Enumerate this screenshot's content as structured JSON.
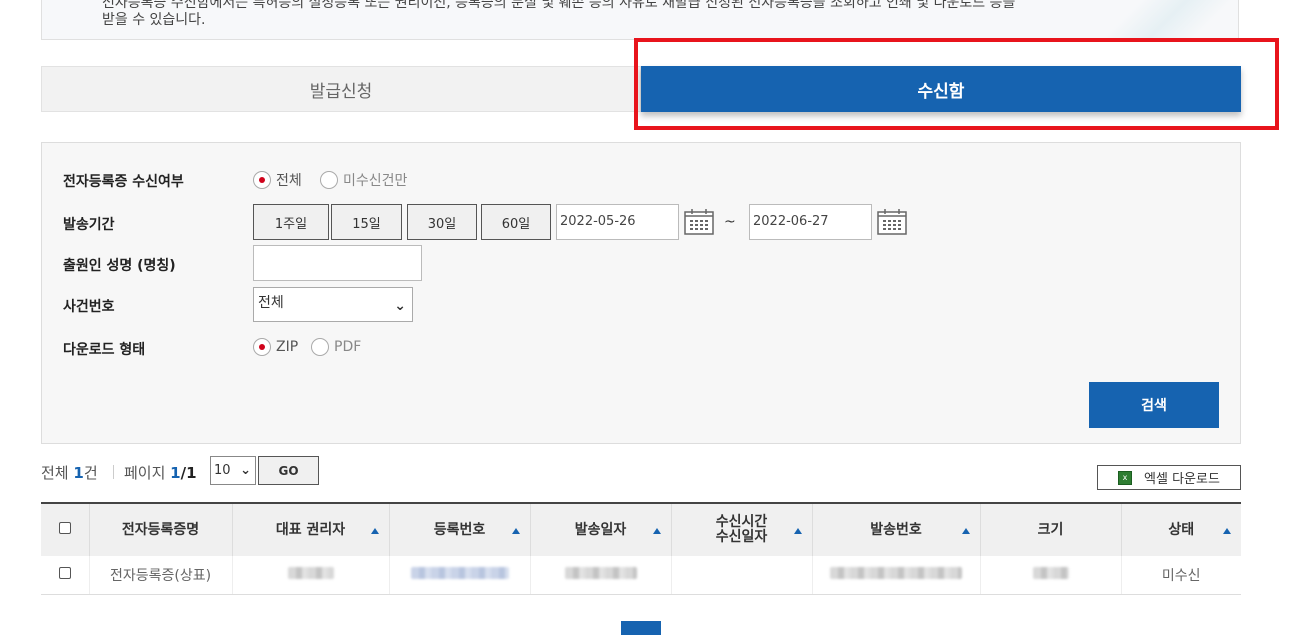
{
  "notice": {
    "line1": "전자등록증 수신함에서는 특허등의 설정등록 또는 권리이전, 등록증의 분실 및 훼손 등의 사유로 재발급 신청된 전자등록증을 조회하고 인쇄 및 다운로드 등을",
    "line2": "받을 수 있습니다."
  },
  "tabs": {
    "apply": "발급신청",
    "inbox": "수신함"
  },
  "filters": {
    "receive_label": "전자등록증 수신여부",
    "receive_opt_all": "전체",
    "receive_opt_unread": "미수신건만",
    "period_label": "발송기간",
    "period_buttons": [
      "1주일",
      "15일",
      "30일",
      "60일"
    ],
    "date_from": "2022-05-26",
    "date_tilde": "~",
    "date_to": "2022-06-27",
    "applicant_label": "출원인 성명 (명칭)",
    "case_label": "사건번호",
    "case_selected": "전체",
    "format_label": "다운로드 형태",
    "format_zip": "ZIP",
    "format_pdf": "PDF",
    "search_button": "검색"
  },
  "summary": {
    "total_prefix": "전체 ",
    "total_count": "1",
    "total_suffix": "건",
    "page_prefix": "페이지 ",
    "page_current": "1",
    "page_total": "/1",
    "page_size": "10",
    "go_button": "GO",
    "excel_button": "엑셀 다운로드"
  },
  "table": {
    "headers": [
      "전자등록증명",
      "대표 권리자",
      "등록번호",
      "발송일자",
      "수신시간",
      "수신일자",
      "발송번호",
      "크기",
      "상태"
    ],
    "rows": [
      {
        "cert_name": "전자등록증(상표)",
        "status": "미수신"
      }
    ]
  },
  "colors": {
    "primary": "#1663b0",
    "highlight": "#e8141c"
  }
}
